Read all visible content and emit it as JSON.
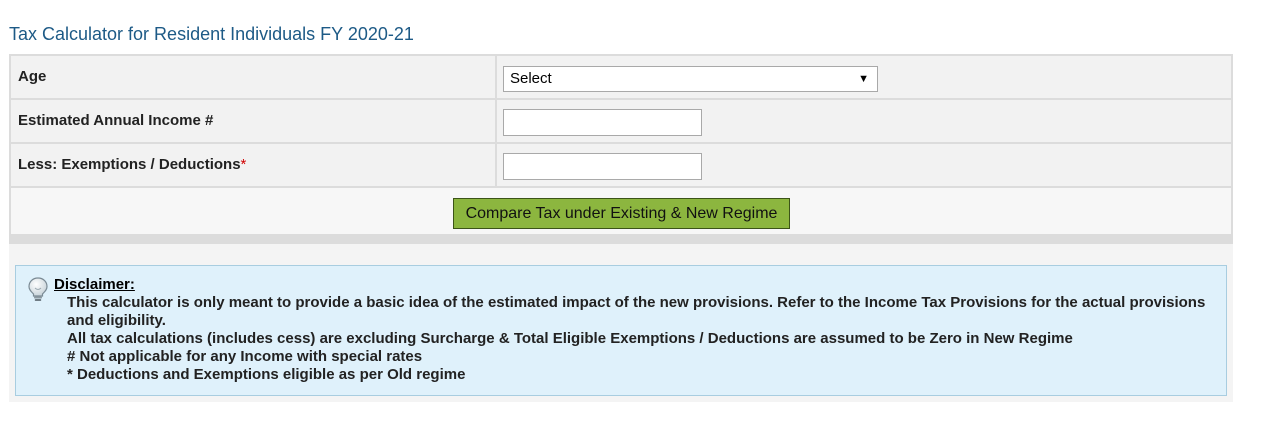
{
  "page": {
    "title": "Tax Calculator for Resident Individuals FY 2020-21"
  },
  "form": {
    "age": {
      "label": "Age",
      "selected": "Select"
    },
    "income": {
      "label": "Estimated Annual Income #",
      "value": ""
    },
    "deductions": {
      "label": "Less: Exemptions / Deductions",
      "required_marker": "*",
      "value": ""
    },
    "compare_button_label": "Compare Tax under Existing & New Regime"
  },
  "disclaimer": {
    "icon": "lightbulb-icon",
    "title": "Disclaimer:",
    "lines": [
      "This calculator is only meant to provide a basic idea of the estimated impact of the new provisions. Refer to the Income Tax Provisions for the actual provisions and eligibility.",
      "All tax calculations (includes cess) are excluding Surcharge & Total Eligible Exemptions / Deductions are assumed to be Zero in New Regime",
      "# Not applicable for any Income with special rates",
      "* Deductions and Exemptions eligible as per Old regime"
    ]
  },
  "colors": {
    "title": "#1d5a86",
    "button_bg": "#8cb63f",
    "disclaimer_bg": "#dff1fb",
    "required": "#d00000"
  }
}
